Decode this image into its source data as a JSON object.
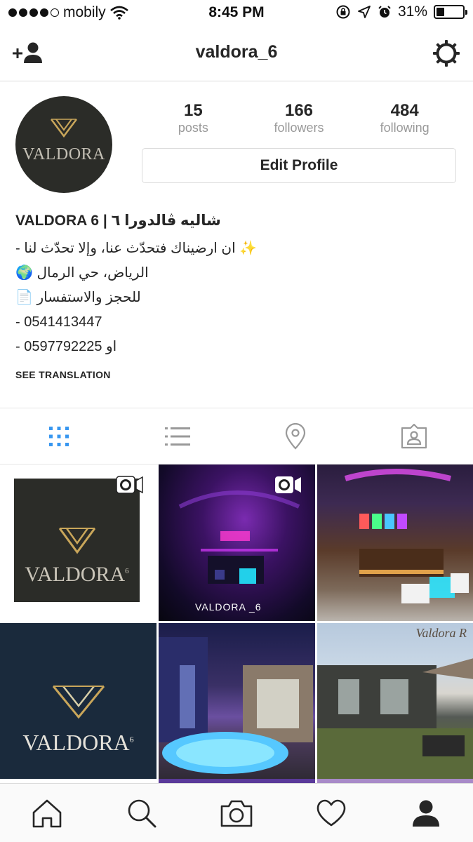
{
  "status_bar": {
    "carrier": "mobily",
    "time": "8:45 PM",
    "battery": "31%",
    "battery_level": 0.31
  },
  "nav": {
    "title": "valdora_6",
    "left_icon": "add-user-icon",
    "right_icon": "gear-icon"
  },
  "profile": {
    "avatar_text": "VALDORA",
    "stats": [
      {
        "value": "15",
        "label": "posts"
      },
      {
        "value": "166",
        "label": "followers"
      },
      {
        "value": "484",
        "label": "following"
      }
    ],
    "edit_button": "Edit Profile"
  },
  "bio": {
    "name": "VALDORA 6 | شاليه ڤالدورا ٦",
    "lines": [
      "- ان ارضيناك فتحدّث عنا، وإلا تحدّث لنا ✨",
      "🌍 الرياض، حي الرمال",
      "📄 للحجز والاستفسار",
      "- 0541413447",
      "- 0597792225 او"
    ],
    "see_translation": "SEE TRANSLATION"
  },
  "tabs": [
    {
      "name": "grid-icon",
      "active": true
    },
    {
      "name": "list-icon",
      "active": false
    },
    {
      "name": "location-pin-icon",
      "active": false
    },
    {
      "name": "tagged-photos-icon",
      "active": false
    }
  ],
  "grid": {
    "tile1_text": "VALDORA",
    "tile1_sup": "6",
    "tile2_caption": "VALDORA _6",
    "tile4_text": "VALDORA",
    "tile4_sup": "6",
    "tile6_watermark": "Valdora R"
  },
  "bottom_bar": [
    {
      "name": "home-icon"
    },
    {
      "name": "search-icon"
    },
    {
      "name": "camera-icon"
    },
    {
      "name": "heart-icon"
    },
    {
      "name": "profile-icon"
    }
  ],
  "colors": {
    "active_tab": "#3897f0",
    "inactive_icon": "#999999",
    "logo_dark": "#2b2c28",
    "logo_gold": "#c9a65a"
  }
}
